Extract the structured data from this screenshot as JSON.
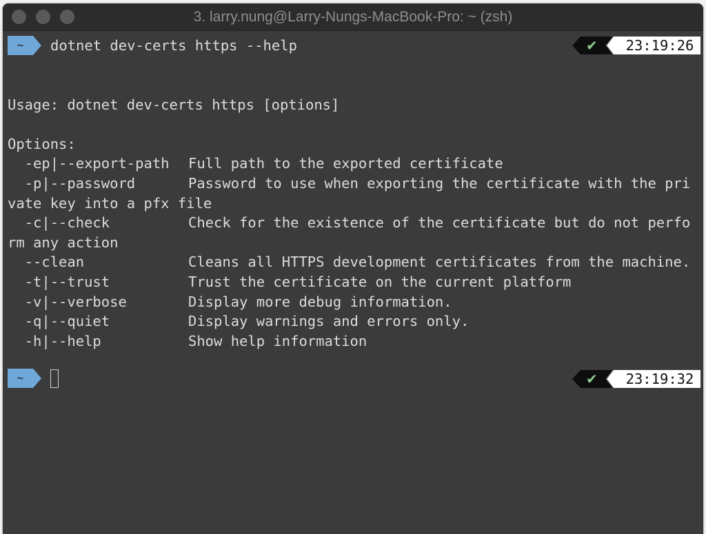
{
  "window": {
    "title": "3. larry.nung@Larry-Nungs-MacBook-Pro: ~ (zsh)"
  },
  "prompts": [
    {
      "dir": "~",
      "command": "dotnet dev-certs https --help",
      "status_icon": "check-icon",
      "time": "23:19:26"
    },
    {
      "dir": "~",
      "command": "",
      "status_icon": "check-icon",
      "time": "23:19:32"
    }
  ],
  "output": {
    "usage": "Usage: dotnet dev-certs https [options]",
    "options_header": "Options:",
    "options": [
      {
        "flag": "-ep|--export-path",
        "desc": "Full path to the exported certificate"
      },
      {
        "flag": "-p|--password",
        "desc": "Password to use when exporting the certificate with the private key into a pfx file",
        "wrap_first": "Password to use when exporting the certificate with the pri",
        "wrap_rest": "vate key into a pfx file"
      },
      {
        "flag": "-c|--check",
        "desc": "Check for the existence of the certificate but do not perform any action",
        "wrap_first": "Check for the existence of the certificate but do not perfo",
        "wrap_rest": "rm any action"
      },
      {
        "flag": "--clean",
        "desc": "Cleans all HTTPS development certificates from the machine."
      },
      {
        "flag": "-t|--trust",
        "desc": "Trust the certificate on the current platform"
      },
      {
        "flag": "-v|--verbose",
        "desc": "Display more debug information."
      },
      {
        "flag": "-q|--quiet",
        "desc": "Display warnings and errors only."
      },
      {
        "flag": "-h|--help",
        "desc": "Show help information"
      }
    ]
  },
  "colors": {
    "prompt_bg": "#6fa7d8",
    "check": "#8fcf8f",
    "background": "#3b3b3b"
  }
}
